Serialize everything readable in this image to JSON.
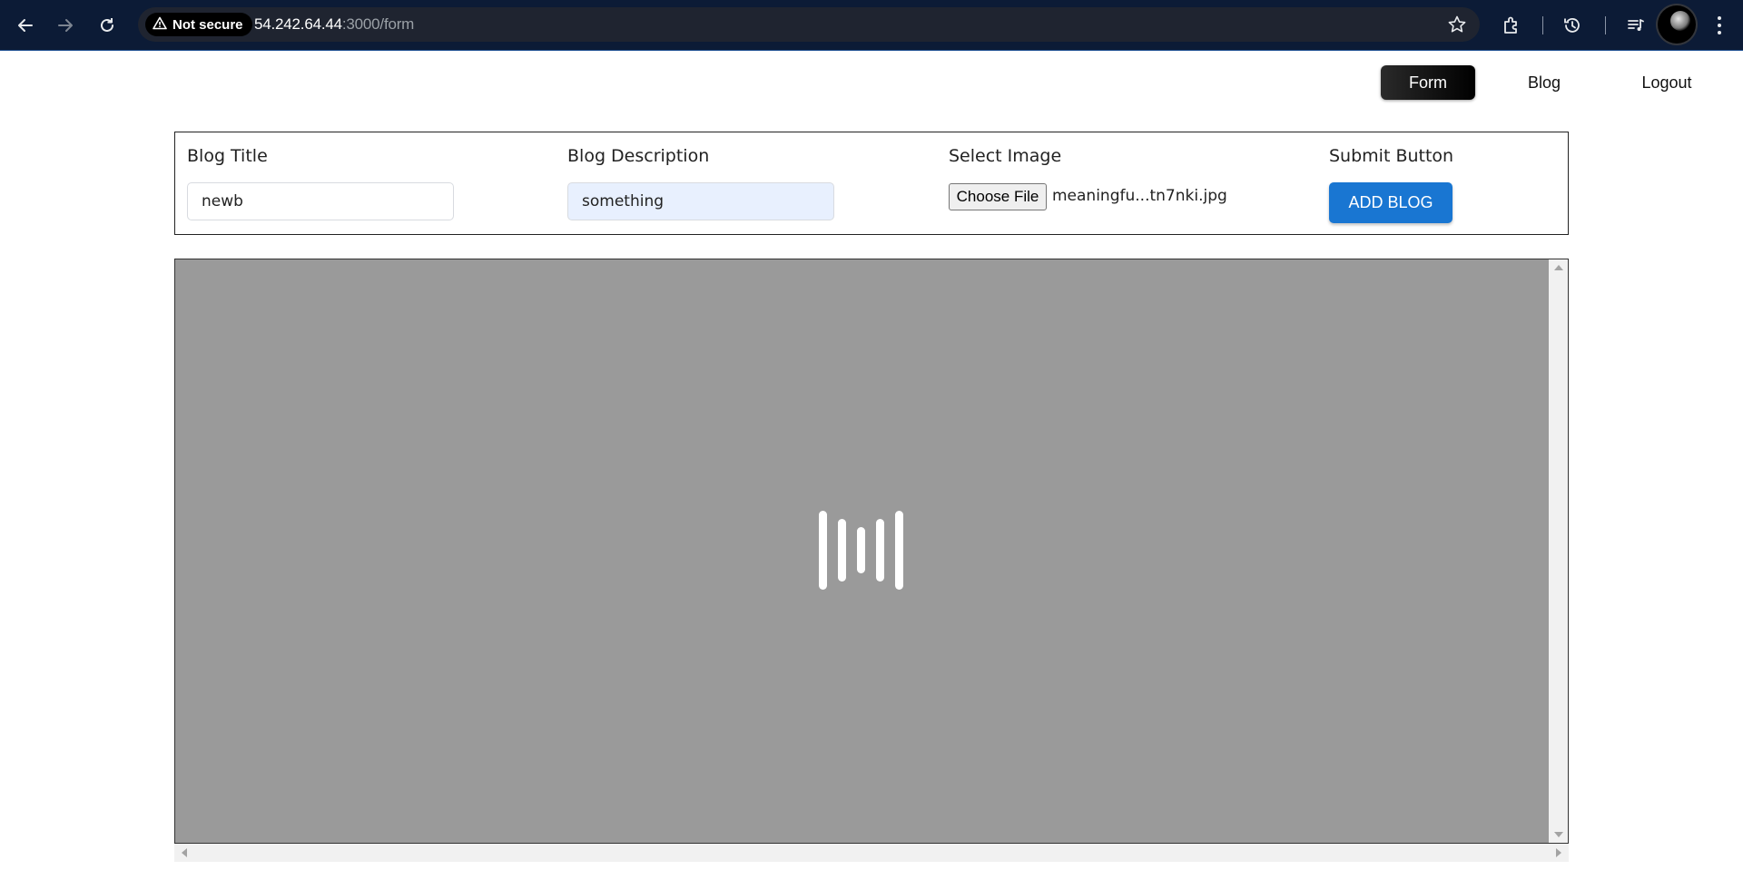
{
  "browser": {
    "security_label": "Not secure",
    "url_host": "54.242.64.44",
    "url_rest": ":3000/form",
    "icons": [
      "back-arrow-icon",
      "forward-arrow-icon",
      "reload-icon",
      "warning-icon",
      "star-icon",
      "extensions-icon",
      "history-icon",
      "media-control-icon",
      "profile-avatar",
      "more-menu-icon"
    ]
  },
  "nav": {
    "form": "Form",
    "blog": "Blog",
    "logout": "Logout",
    "active": "Form"
  },
  "form": {
    "title_label": "Blog Title",
    "title_value": "newb",
    "description_label": "Blog Description",
    "description_value": "something",
    "image_label": "Select Image",
    "choose_file_label": "Choose File",
    "file_name": "meaningfu...tn7nki.jpg",
    "submit_label": "Submit Button",
    "add_button": "ADD BLOG"
  },
  "viewer": {
    "state": "loading",
    "icon": "loading-bars-icon"
  },
  "colors": {
    "chrome_bg": "#0c1b36",
    "primary_button": "#1976d2",
    "active_nav": "#111111",
    "viewer_bg": "#9a9a9a",
    "autofill_bg": "#e8f0fe"
  }
}
